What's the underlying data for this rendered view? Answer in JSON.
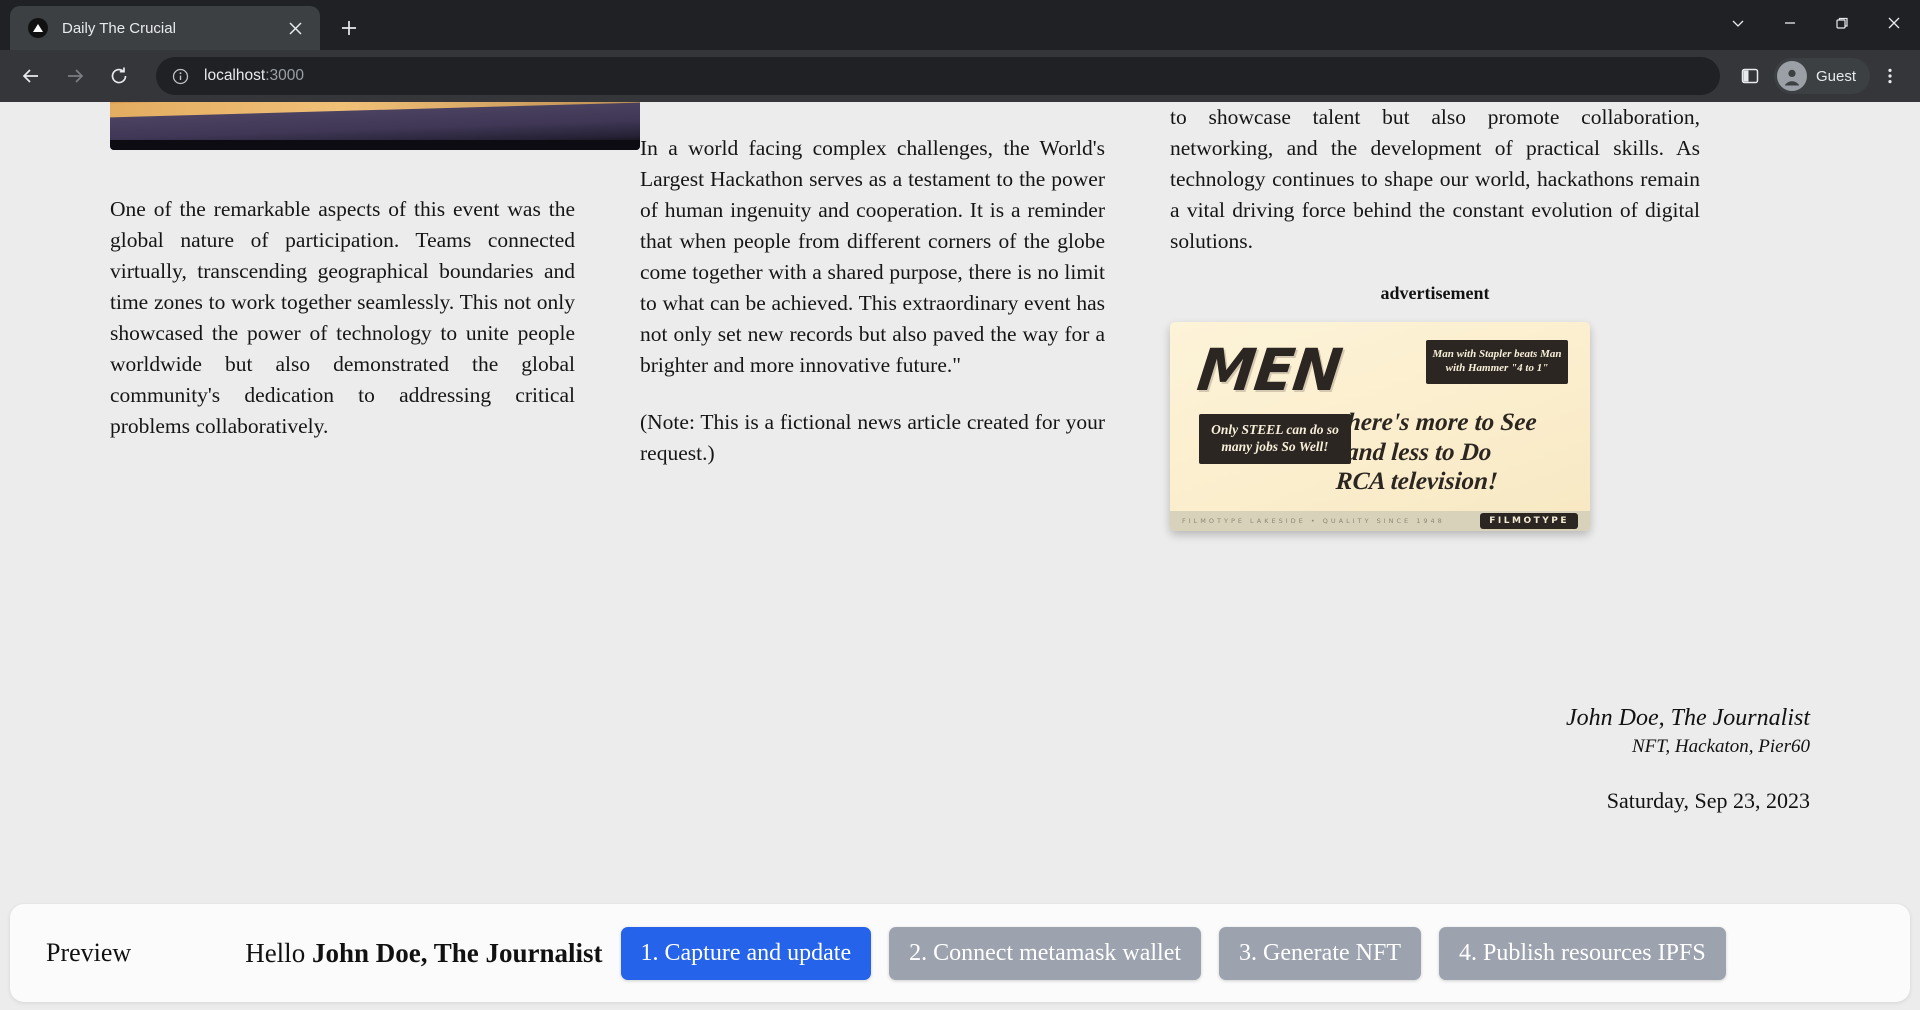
{
  "browser": {
    "tab": {
      "title": "Daily The Crucial",
      "favicon_icon": "triangle-logo-icon",
      "close_icon": "✕"
    },
    "new_tab_icon": "+",
    "window_controls": {
      "chevron_down_icon": "chevron-down-icon",
      "minimize_icon": "minimize-icon",
      "restore_icon": "restore-icon",
      "close_icon": "close-icon"
    },
    "nav": {
      "back_icon": "←",
      "forward_icon": "→",
      "reload_icon": "⟳"
    },
    "omnibox": {
      "info_icon": "info-circle-icon",
      "url_host": "localhost",
      "url_port": ":3000"
    },
    "toolbar_right": {
      "side_panel_icon": "side-panel-icon",
      "profile_label": "Guest",
      "menu_icon": "⋮"
    }
  },
  "article": {
    "columns": [
      {
        "has_image": true,
        "paragraphs": [
          "One of the remarkable aspects of this event was the global nature of participation. Teams connected virtually, transcending geographical boundaries and time zones to work together seamlessly. This not only showcased the power of technology to unite people worldwide but also demonstrated the global community's dedication to addressing critical problems collaboratively."
        ]
      },
      {
        "has_image": false,
        "paragraphs": [
          "In a world facing complex challenges, the World's Largest Hackathon serves as a testament to the power of human ingenuity and cooperation. It is a reminder that when people from different corners of the globe come together with a shared purpose, there is no limit to what can be achieved. This extraordinary event has not only set new records but also paved the way for a brighter and more innovative future.\"",
          "(Note: This is a fictional news article created for your request.)"
        ]
      },
      {
        "has_image": false,
        "paragraphs": [
          "to showcase talent but also promote collaboration, networking, and the development of practical skills. As technology continues to shape our world, hackathons remain a vital driving force behind the constant evolution of digital solutions."
        ]
      }
    ],
    "advertisement": {
      "label": "advertisement",
      "headline": "MEN",
      "box_steel": "Only STEEL can do so many jobs So Well!",
      "box_stapler": "Man with Stapler beats Man with Hammer \"4 to 1\"",
      "script_lines": [
        "there's more to See",
        "-and less to Do",
        "RCA television!"
      ],
      "footer_left": "FILMOTYPE LAKESIDE • QUALITY SINCE 1948",
      "brand": "FILMOTYPE",
      "paper_color": "#fbeecd",
      "ink_color": "#2b2622"
    },
    "signature": {
      "name": "John Doe, The Journalist",
      "subtitle": "NFT, Hackaton, Pier60",
      "date": "Saturday, Sep 23, 2023"
    }
  },
  "action_bar": {
    "title": "Preview",
    "greeting_prefix": "Hello ",
    "greeting_name": "John Doe, The Journalist",
    "buttons": [
      {
        "label": "1. Capture and update",
        "style": "primary"
      },
      {
        "label": "2. Connect metamask wallet",
        "style": "muted"
      },
      {
        "label": "3. Generate NFT",
        "style": "muted"
      },
      {
        "label": "4. Publish resources IPFS",
        "style": "muted"
      }
    ],
    "accent_color": "#2563eb",
    "muted_color": "#9ca3af"
  }
}
